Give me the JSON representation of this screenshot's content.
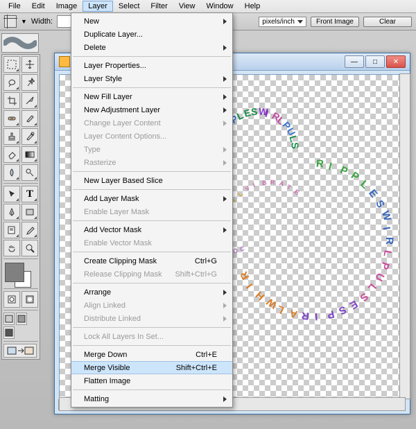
{
  "menubar": [
    "File",
    "Edit",
    "Image",
    "Layer",
    "Select",
    "Filter",
    "View",
    "Window",
    "Help"
  ],
  "menubar_active_index": 3,
  "options": {
    "width_label": "Width:",
    "units": "pixels/inch",
    "front_btn": "Front Image",
    "clear_btn": "Clear"
  },
  "doc": {
    "min": "—",
    "max": "□",
    "close": "✕",
    "status": ""
  },
  "menu": {
    "items": [
      {
        "label": "New",
        "sub": true
      },
      {
        "label": "Duplicate Layer..."
      },
      {
        "label": "Delete",
        "sub": true
      },
      {
        "sep": true
      },
      {
        "label": "Layer Properties..."
      },
      {
        "label": "Layer Style",
        "sub": true
      },
      {
        "sep": true
      },
      {
        "label": "New Fill Layer",
        "sub": true
      },
      {
        "label": "New Adjustment Layer",
        "sub": true
      },
      {
        "label": "Change Layer Content",
        "sub": true,
        "disabled": true
      },
      {
        "label": "Layer Content Options...",
        "disabled": true
      },
      {
        "label": "Type",
        "sub": true,
        "disabled": true
      },
      {
        "label": "Rasterize",
        "sub": true,
        "disabled": true
      },
      {
        "sep": true
      },
      {
        "label": "New Layer Based Slice"
      },
      {
        "sep": true
      },
      {
        "label": "Add Layer Mask",
        "sub": true
      },
      {
        "label": "Enable Layer Mask",
        "disabled": true
      },
      {
        "sep": true
      },
      {
        "label": "Add Vector Mask",
        "sub": true
      },
      {
        "label": "Enable Vector Mask",
        "disabled": true
      },
      {
        "sep": true
      },
      {
        "label": "Create Clipping Mask",
        "shortcut": "Ctrl+G"
      },
      {
        "label": "Release Clipping Mask",
        "shortcut": "Shift+Ctrl+G",
        "disabled": true
      },
      {
        "sep": true
      },
      {
        "label": "Arrange",
        "sub": true
      },
      {
        "label": "Align Linked",
        "sub": true,
        "disabled": true
      },
      {
        "label": "Distribute Linked",
        "sub": true,
        "disabled": true
      },
      {
        "sep": true
      },
      {
        "label": "Lock All Layers In Set...",
        "disabled": true
      },
      {
        "sep": true
      },
      {
        "label": "Merge Down",
        "shortcut": "Ctrl+E"
      },
      {
        "label": "Merge Visible",
        "shortcut": "Shift+Ctrl+E",
        "highlight": true
      },
      {
        "label": "Flatten Image"
      },
      {
        "sep": true
      },
      {
        "label": "Matting",
        "sub": true
      }
    ]
  },
  "curve_arc": {
    "text": "RIPPLESWIRLPULS",
    "colors": [
      "#7a5bd6",
      "#7a5bd6",
      "#3b77d1",
      "#3b77d1",
      "#1a8d4a",
      "#1a8d4a",
      "#1a8d4a",
      "#8434c4",
      "#8434c4",
      "#c04aa1",
      "#c04aa1",
      "#3b77d1",
      "#3b77d1",
      "#1a8d4a",
      "#1a8d4a"
    ]
  },
  "curve_big": {
    "text": "RIPPLESWIRLPULSESPIRALWHIR",
    "colors": [
      "#39a33f",
      "#39a33f",
      "#39a33f",
      "#39a33f",
      "#39a33f",
      "#3867bd",
      "#3867bd",
      "#3867bd",
      "#3867bd",
      "#3867bd",
      "#c94d9a",
      "#c94d9a",
      "#c94d9a",
      "#c94d9a",
      "#c94d9a",
      "#7d43c8",
      "#7d43c8",
      "#7d43c8",
      "#7d43c8",
      "#7d43c8",
      "#d77d2a",
      "#d77d2a",
      "#d77d2a",
      "#d77d2a",
      "#d77d2a",
      "#d77d2a"
    ]
  },
  "curve_bot": {
    "text": "ATESPIRALWHIRL",
    "colors": [
      "#d18a2a",
      "#d18a2a",
      "#d18a2a",
      "#7d43c8",
      "#7d43c8",
      "#7d43c8",
      "#7d43c8",
      "#3b77d1",
      "#3b77d1",
      "#3b77d1",
      "#c04aa1",
      "#c04aa1",
      "#c04aa1",
      "#c04aa1"
    ]
  },
  "curve_inner": {
    "text": "COILVIBRATE",
    "colors": [
      "#b77dc9",
      "#b77dc9",
      "#b77dc9",
      "#b77dc9",
      "#d8a0bf",
      "#d8a0bf",
      "#d8a0bf",
      "#d8a0bf",
      "#d8a0bf",
      "#d8a0bf",
      "#d8a0bf"
    ]
  },
  "curve_inner2": {
    "text": "COILVIBRATE",
    "colors": [
      "#d7a33a",
      "#d7a33a",
      "#d7a33a",
      "#d7a33a",
      "#c86fae",
      "#c86fae",
      "#c86fae",
      "#c86fae",
      "#c86fae",
      "#c86fae",
      "#c86fae"
    ]
  }
}
